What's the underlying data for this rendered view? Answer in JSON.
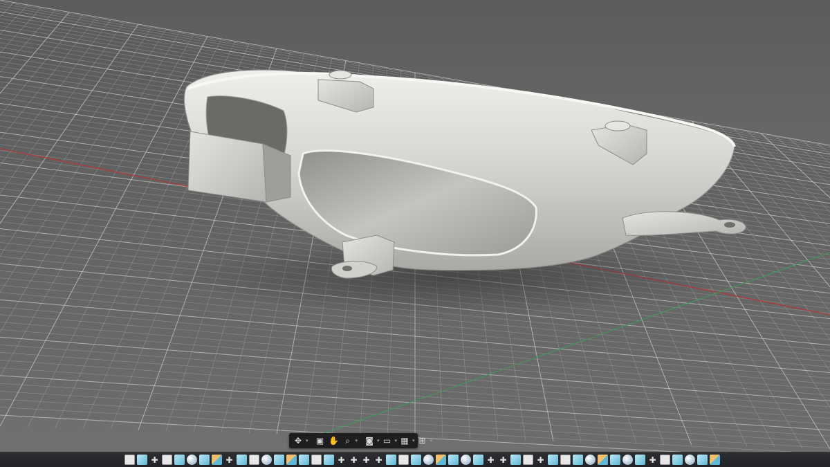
{
  "app": {
    "name": "",
    "view": "3D viewport"
  },
  "colors": {
    "background": "#666666",
    "grid_line": "#c8c8c8",
    "x_axis": "#b03a3a",
    "y_axis": "#3f9a5a",
    "model": "#d4d4d0",
    "toolbar_bg": "#232428",
    "accent": "#5fb8d6"
  },
  "navigation_bar": {
    "items": [
      {
        "icon": "orbit-icon",
        "glyph": "✥",
        "has_dropdown": true
      },
      {
        "icon": "look-at-icon",
        "glyph": "▣",
        "has_dropdown": false
      },
      {
        "icon": "pan-hand-icon",
        "glyph": "✋",
        "has_dropdown": false
      },
      {
        "icon": "zoom-icon",
        "glyph": "⌕",
        "has_dropdown": true
      },
      {
        "icon": "display-mode-icon",
        "glyph": "◙",
        "has_dropdown": true
      },
      {
        "icon": "visual-style-icon",
        "glyph": "▭",
        "has_dropdown": true
      },
      {
        "icon": "grid-icon",
        "glyph": "▦",
        "has_dropdown": true
      },
      {
        "icon": "viewports-icon",
        "glyph": "⊞",
        "has_dropdown": true
      }
    ]
  },
  "bottom_toolbar": {
    "items": [
      {
        "icon": "sketch-icon",
        "style": "sheet",
        "glyph": ""
      },
      {
        "icon": "box-icon",
        "style": "cube",
        "glyph": ""
      },
      {
        "icon": "move-icon",
        "style": "move",
        "glyph": "✚"
      },
      {
        "icon": "sheet-icon",
        "style": "sheet",
        "glyph": ""
      },
      {
        "icon": "box-icon",
        "style": "cube",
        "glyph": ""
      },
      {
        "icon": "sphere-icon",
        "style": "sphere",
        "glyph": ""
      },
      {
        "icon": "box-icon",
        "style": "cube",
        "glyph": ""
      },
      {
        "icon": "combine-icon",
        "style": "combine",
        "glyph": ""
      },
      {
        "icon": "move-icon",
        "style": "move",
        "glyph": "✚"
      },
      {
        "icon": "box-icon",
        "style": "cube",
        "glyph": ""
      },
      {
        "icon": "sheet-icon",
        "style": "sheet",
        "glyph": ""
      },
      {
        "icon": "sphere-icon",
        "style": "sphere",
        "glyph": ""
      },
      {
        "icon": "box-icon",
        "style": "cube",
        "glyph": ""
      },
      {
        "icon": "combine-icon",
        "style": "combine",
        "glyph": ""
      },
      {
        "icon": "box-icon",
        "style": "cube",
        "glyph": ""
      },
      {
        "icon": "sheet-icon",
        "style": "sheet",
        "glyph": ""
      },
      {
        "icon": "box-icon",
        "style": "cube",
        "glyph": ""
      },
      {
        "icon": "move-icon",
        "style": "move",
        "glyph": "✚"
      },
      {
        "icon": "move-icon",
        "style": "move",
        "glyph": "✚"
      },
      {
        "icon": "move-icon",
        "style": "move",
        "glyph": "✚"
      },
      {
        "icon": "move-icon",
        "style": "move",
        "glyph": "✚"
      },
      {
        "icon": "box-icon",
        "style": "cube",
        "glyph": ""
      },
      {
        "icon": "sheet-icon",
        "style": "sheet",
        "glyph": ""
      },
      {
        "icon": "box-icon",
        "style": "cube",
        "glyph": ""
      },
      {
        "icon": "sphere-icon",
        "style": "sphere",
        "glyph": ""
      },
      {
        "icon": "combine-icon",
        "style": "combine",
        "glyph": ""
      },
      {
        "icon": "box-icon",
        "style": "cube",
        "glyph": ""
      },
      {
        "icon": "sphere-icon",
        "style": "sphere",
        "glyph": ""
      },
      {
        "icon": "box-icon",
        "style": "cube",
        "glyph": ""
      },
      {
        "icon": "move-icon",
        "style": "move",
        "glyph": "✚"
      },
      {
        "icon": "move-icon",
        "style": "move",
        "glyph": "✚"
      },
      {
        "icon": "box-icon",
        "style": "cube",
        "glyph": ""
      },
      {
        "icon": "sheet-icon",
        "style": "sheet",
        "glyph": ""
      },
      {
        "icon": "move-icon",
        "style": "move",
        "glyph": "✚"
      },
      {
        "icon": "box-icon",
        "style": "cube",
        "glyph": ""
      },
      {
        "icon": "sheet-icon",
        "style": "sheet",
        "glyph": ""
      },
      {
        "icon": "box-icon",
        "style": "cube",
        "glyph": ""
      },
      {
        "icon": "sphere-icon",
        "style": "sphere",
        "glyph": ""
      },
      {
        "icon": "combine-icon",
        "style": "combine",
        "glyph": ""
      },
      {
        "icon": "box-icon",
        "style": "cube",
        "glyph": ""
      },
      {
        "icon": "sphere-icon",
        "style": "sphere",
        "glyph": ""
      },
      {
        "icon": "box-icon",
        "style": "cube",
        "glyph": ""
      },
      {
        "icon": "move-icon",
        "style": "move",
        "glyph": "✚"
      },
      {
        "icon": "sheet-icon",
        "style": "sheet",
        "glyph": ""
      },
      {
        "icon": "box-icon",
        "style": "cube",
        "glyph": ""
      },
      {
        "icon": "sphere-icon",
        "style": "sphere",
        "glyph": ""
      },
      {
        "icon": "box-icon",
        "style": "cube",
        "glyph": ""
      },
      {
        "icon": "combine-icon",
        "style": "combine",
        "glyph": ""
      }
    ]
  }
}
